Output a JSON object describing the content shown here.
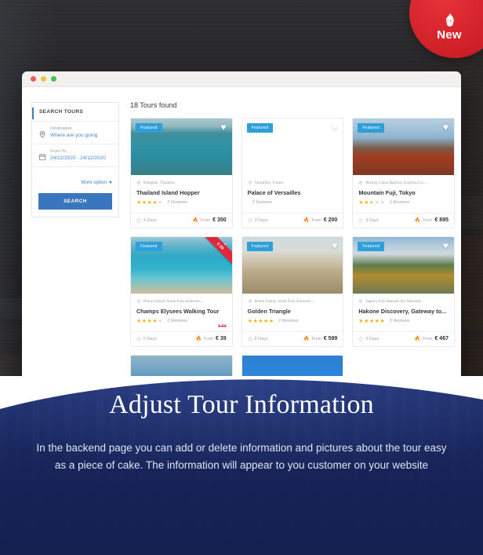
{
  "badge": {
    "label": "New",
    "icon": "flame-icon",
    "color": "#cf2027"
  },
  "browser": {
    "dots": [
      "close",
      "minimize",
      "maximize"
    ]
  },
  "search_panel": {
    "title": "SEARCH TOURS",
    "fields": [
      {
        "icon": "map-pin-icon",
        "label": "Destination",
        "value": "Where are you going"
      },
      {
        "icon": "calendar-icon",
        "label": "From-To",
        "value": "24/12/2020 - 24/12/2020"
      }
    ],
    "more_option": "More option",
    "search_button": "SEARCH"
  },
  "results": {
    "count_label": "18 Tours found",
    "from_label": "From",
    "featured_label": "Featured",
    "cards": [
      {
        "featured": true,
        "location": "Bangkok, Thailand",
        "title": "Thailand Island Hopper",
        "stars": 4,
        "reviews": "2 Reviews",
        "days": "4 Days",
        "price": "€ 350",
        "old_price": null,
        "ribbon": null,
        "image": "thailand-island"
      },
      {
        "featured": true,
        "location": "Versailles, France",
        "title": "Palace of Versailles",
        "stars": 0,
        "reviews": "2 Reviews",
        "days": "3 Days",
        "price": "€ 200",
        "old_price": null,
        "ribbon": null,
        "image": "versailles-hall"
      },
      {
        "featured": true,
        "location": "Beijing China Railway Express Co.,...",
        "title": "Mountain Fuji, Tokyo",
        "stars": 2.5,
        "reviews": "2 Reviews",
        "days": "3 Days",
        "price": "€ 895",
        "old_price": null,
        "ribbon": null,
        "image": "fuji-pagoda"
      },
      {
        "featured": true,
        "location": "Buton Island, South East Sulawesi,...",
        "title": "Champs Elysees Walking Tour",
        "stars": 4,
        "reviews": "2 Reviews",
        "days": "5 Days",
        "price": "€ 39",
        "old_price": "€ 69",
        "ribbon": "€ 39",
        "image": "boat-beach"
      },
      {
        "featured": true,
        "location": "Buton Island, South East Sulawesi,...",
        "title": "Golden Triangle",
        "stars": 5,
        "reviews": "2 Reviews",
        "days": "8 Days",
        "price": "€ 599",
        "old_price": null,
        "ribbon": null,
        "image": "india-gate"
      },
      {
        "featured": true,
        "location": "Japan's Fuji-Hakone-Izu National...",
        "title": "Hakone Discovery, Gateway to...",
        "stars": 5,
        "reviews": "2 Reviews",
        "days": "3 Days",
        "price": "€ 467",
        "old_price": null,
        "ribbon": null,
        "image": "mountain-road"
      }
    ],
    "partial_cards": [
      {
        "image": "coastal-cliff"
      },
      {
        "image": "blue-sky-sea"
      }
    ]
  },
  "panel": {
    "title": "Adjust Tour Information",
    "description": "In the backend page you can add or delete information and pictures about the tour easy as a piece of cake. The information will appear to you customer on your website",
    "background_color": "#1f2f6e"
  }
}
